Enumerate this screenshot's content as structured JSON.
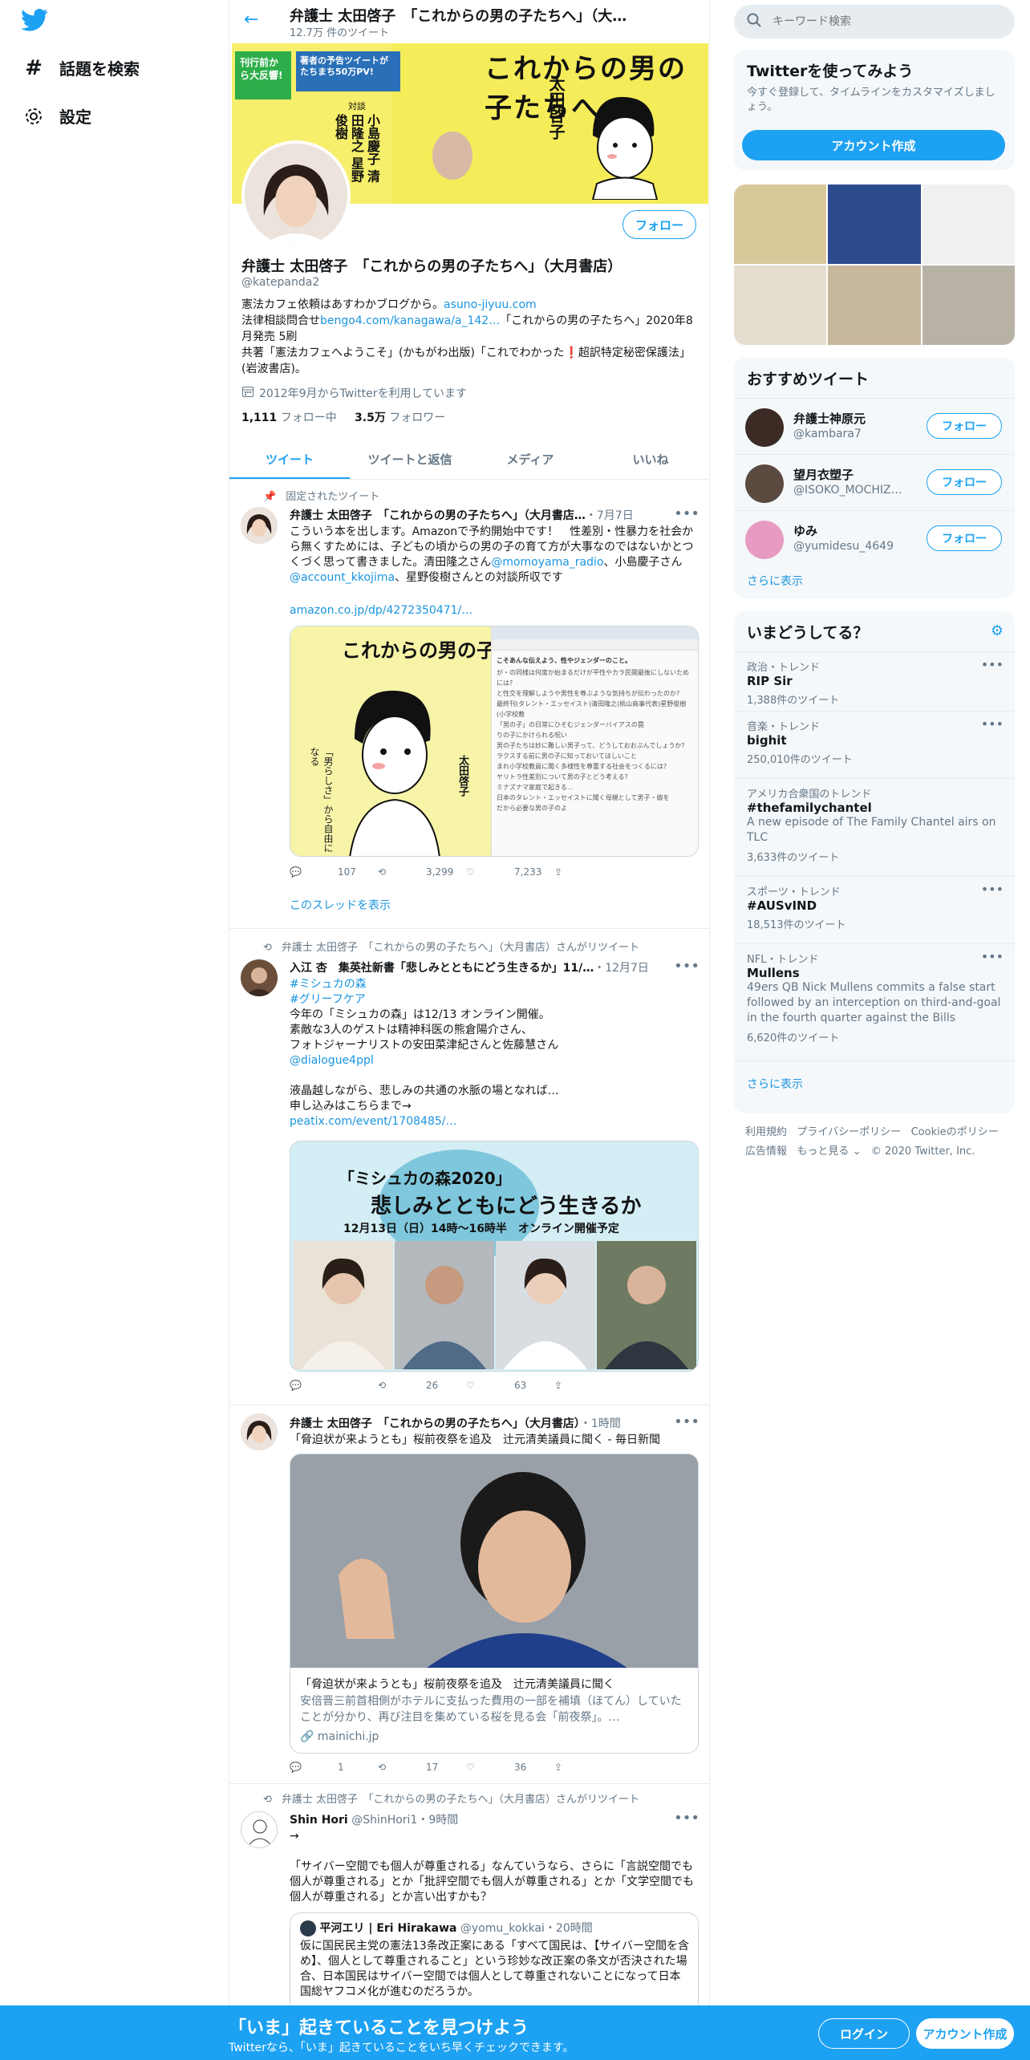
{
  "nav": {
    "explore": "話題を検索",
    "settings": "設定"
  },
  "topbar": {
    "title": "弁護士 太田啓子　「これからの男の子たちへ」（大…",
    "subtitle": "12.7万 件のツイート"
  },
  "banner": {
    "headline": "これからの男の子たちへ",
    "badge": "刊行前から大反響!",
    "promo": "著者の予告ツイートがたちまち50万PV!",
    "authors": "小島慶子 清田隆之 星野俊樹",
    "author": "太田啓子",
    "taidan": "対談"
  },
  "profile": {
    "follow": "フォロー",
    "name": "弁護士 太田啓子　「これからの男の子たちへ」（大月書店）",
    "handle": "@katepanda2",
    "bio1a": "憲法カフェ依頼はあすわかブログから。",
    "bio1b": "asuno-jiyuu.com",
    "bio2a": "法律相談問合せ",
    "bio2b": "bengo4.com/kanagawa/a_142…",
    "bio2c": "「これからの男の子たちへ」2020年8月発売 5刷",
    "bio3": "共著「憲法カフェへようこそ」(かもがわ出版)「これでわかった❗超訳特定秘密保護法」(岩波書店)。",
    "joined": "2012年9月からTwitterを利用しています",
    "following_n": "1,111",
    "following_l": "フォロー中",
    "followers_n": "3.5万",
    "followers_l": "フォロワー"
  },
  "tabs": [
    "ツイート",
    "ツイートと返信",
    "メディア",
    "いいね"
  ],
  "tweets": {
    "t1": {
      "pinned": "固定されたツイート",
      "name": "弁護士 太田啓子　「これからの男の子たちへ」（大月書店…",
      "time": "・7月7日",
      "text1": "こういう本を出します。Amazonで予約開始中です！　性差別・性暴力を社会から無くすためには、子どもの頃からの男の子の育て方が大事なのではないかとつくづく思って書きました。清田隆之さん",
      "m1": "@momoyama_radio",
      "text2": "、小島慶子さん",
      "m2": "@account_kkojima",
      "text3": "、星野俊樹さんとの対談所収です",
      "link": "amazon.co.jp/dp/4272350471/…",
      "img_title": "これからの男の子たちへ",
      "img_author": "太田啓子",
      "img_side": "「男らしさ」から自由になる",
      "ss_line1": "こそあんな伝えよう、性やジェンダーのこと。",
      "ss_lines": [
        "が・の同様は何度か始まるだけが平性やカラ民間最後にしないためには?",
        "と性交を理解しようや男性を尊ぶような気持ちが伝わったのか?",
        "最終刊(タレント・エッセイスト)清田隆之(桃山商事代表)星野俊樹(小学校教",
        "「男の子」の日常にひそむジェンダーバイアスの罠",
        "りの子にかけられる呪い",
        "男の子たちは妙に難しい男子って、どうしておおぶんでしょうか?",
        "ラクスする前に男の子に知っておいてほしいこと",
        "まれ小学校教員に聞く多様性を尊重する社会をつくるには?",
        "ヤリトラ性差別について男の子とどう考える?",
        "ミナズナマ家庭で起きる…",
        "日本のタレント・エッセイストに聞く母親として男子・娘を",
        "だから必要な男の子のよ"
      ],
      "reply": "107",
      "rt": "3,299",
      "like": "7,233",
      "thread": "このスレッドを表示"
    },
    "t2": {
      "rtby": "弁護士 太田啓子　「これからの男の子たちへ」（大月書店）さんがリツイート",
      "name": "入江 杏　集英社新書「悲しみとともにどう生きるか」11/…",
      "time": "・12月7日",
      "h1": "#ミシュカの森",
      "h2": "#グリーフケア",
      "l1": "今年の「ミシュカの森」は12/13 オンライン開催。",
      "l2": "素敵な3人のゲストは精神科医の熊倉陽介さん、",
      "l3": "フォトジャーナリストの安田菜津紀さんと佐藤慧さん",
      "m": "@dialogue4ppl",
      "l4": "液晶越しながら、悲しみの共通の水脈の場となれば…",
      "l5": "申し込みはこちらまで→",
      "link": "peatix.com/event/1708485/…",
      "img_t1": "「ミシュカの森2020」",
      "img_t2": "悲しみとともにどう生きるか",
      "img_t3": "12月13日（日）14時〜16時半　オンライン開催予定",
      "reply": "",
      "rt": "26",
      "like": "63"
    },
    "t3": {
      "name": "弁護士 太田啓子　「これからの男の子たちへ」（大月書店）",
      "time": "・1時間",
      "text": "「脅迫状が来ようとも」桜前夜祭を追及　辻元清美議員に聞く - 毎日新聞",
      "card_title": "「脅迫状が来ようとも」桜前夜祭を追及　辻元清美議員に聞く",
      "card_desc": "安倍晋三前首相側がホテルに支払った費用の一部を補填（ほてん）していたことが分かり、再び注目を集めている桜を見る会「前夜祭」。…",
      "card_domain": "mainichi.jp",
      "reply": "1",
      "rt": "17",
      "like": "36"
    },
    "t4": {
      "rtby": "弁護士 太田啓子　「これからの男の子たちへ」（大月書店）さんがリツイート",
      "name": "Shin Hori",
      "handle": "@ShinHori1",
      "time": "・9時間",
      "arrow": "→",
      "text": "「サイバー空間でも個人が尊重される」なんていうなら、さらに「言説空間でも個人が尊重される」とか「批評空間でも個人が尊重される」とか「文学空間でも個人が尊重される」とか言い出すかも？",
      "q_name": "平河エリ | Eri Hirakawa",
      "q_handle": "@yomu_kokkai",
      "q_time": "・20時間",
      "q_text": "仮に国民民主党の憲法13条改正案にある「すべて国民は、【サイバー空間を含め】、個人として尊重されること」という珍妙な改正案の条文が否決された場合、日本国民はサイバー空間では個人として尊重されないことになって日本国総ヤフコメ化が進むのだろうか。"
    }
  },
  "right": {
    "search_placeholder": "キーワード検索",
    "signup": {
      "title": "Twitterを使ってみよう",
      "desc": "今すぐ登録して、タイムラインをカスタマイズしましょう。",
      "button": "アカウント作成"
    },
    "recommend": {
      "title": "おすすめツイート",
      "users": [
        {
          "name": "弁護士神原元",
          "handle": "@kambara7"
        },
        {
          "name": "望月衣塑子",
          "handle": "@ISOKO_MOCHIZ…"
        },
        {
          "name": "ゆみ",
          "handle": "@yumidesu_4649"
        }
      ],
      "follow": "フォロー",
      "more": "さらに表示"
    },
    "trends": {
      "title": "いまどうしてる？",
      "items": [
        {
          "cat": "政治・トレンド",
          "name": "RIP Sir",
          "desc": "",
          "count": "1,388件のツイート"
        },
        {
          "cat": "音楽・トレンド",
          "name": "bighit",
          "desc": "",
          "count": "250,010件のツイート"
        },
        {
          "cat": "アメリカ合衆国のトレンド",
          "name": "#thefamilychantel",
          "desc": "A new episode of The Family Chantel airs on TLC",
          "count": "3,633件のツイート"
        },
        {
          "cat": "スポーツ・トレンド",
          "name": "#AUSvIND",
          "desc": "",
          "count": "18,513件のツイート"
        },
        {
          "cat": "NFL・トレンド",
          "name": "Mullens",
          "desc": "49ers QB Nick Mullens commits a false start followed by an interception on third-and-goal in the fourth quarter against the Bills",
          "count": "6,620件のツイート"
        }
      ],
      "more": "さらに表示"
    },
    "footer": {
      "l1": "利用規約",
      "l2": "プライバシーポリシー",
      "l3": "Cookieのポリシー",
      "l4": "広告情報",
      "l5": "もっと見る",
      "copy": "© 2020 Twitter, Inc."
    }
  },
  "bottombar": {
    "title": "「いま」起きていることを見つけよう",
    "sub": "Twitterなら、「いま」起きていることをいち早くチェックできます。",
    "login": "ログイン",
    "signup": "アカウント作成"
  },
  "colors": {
    "accent": "#1da1f2",
    "link": "#1b95e0",
    "muted": "#657786",
    "border": "#e6ecf0"
  }
}
